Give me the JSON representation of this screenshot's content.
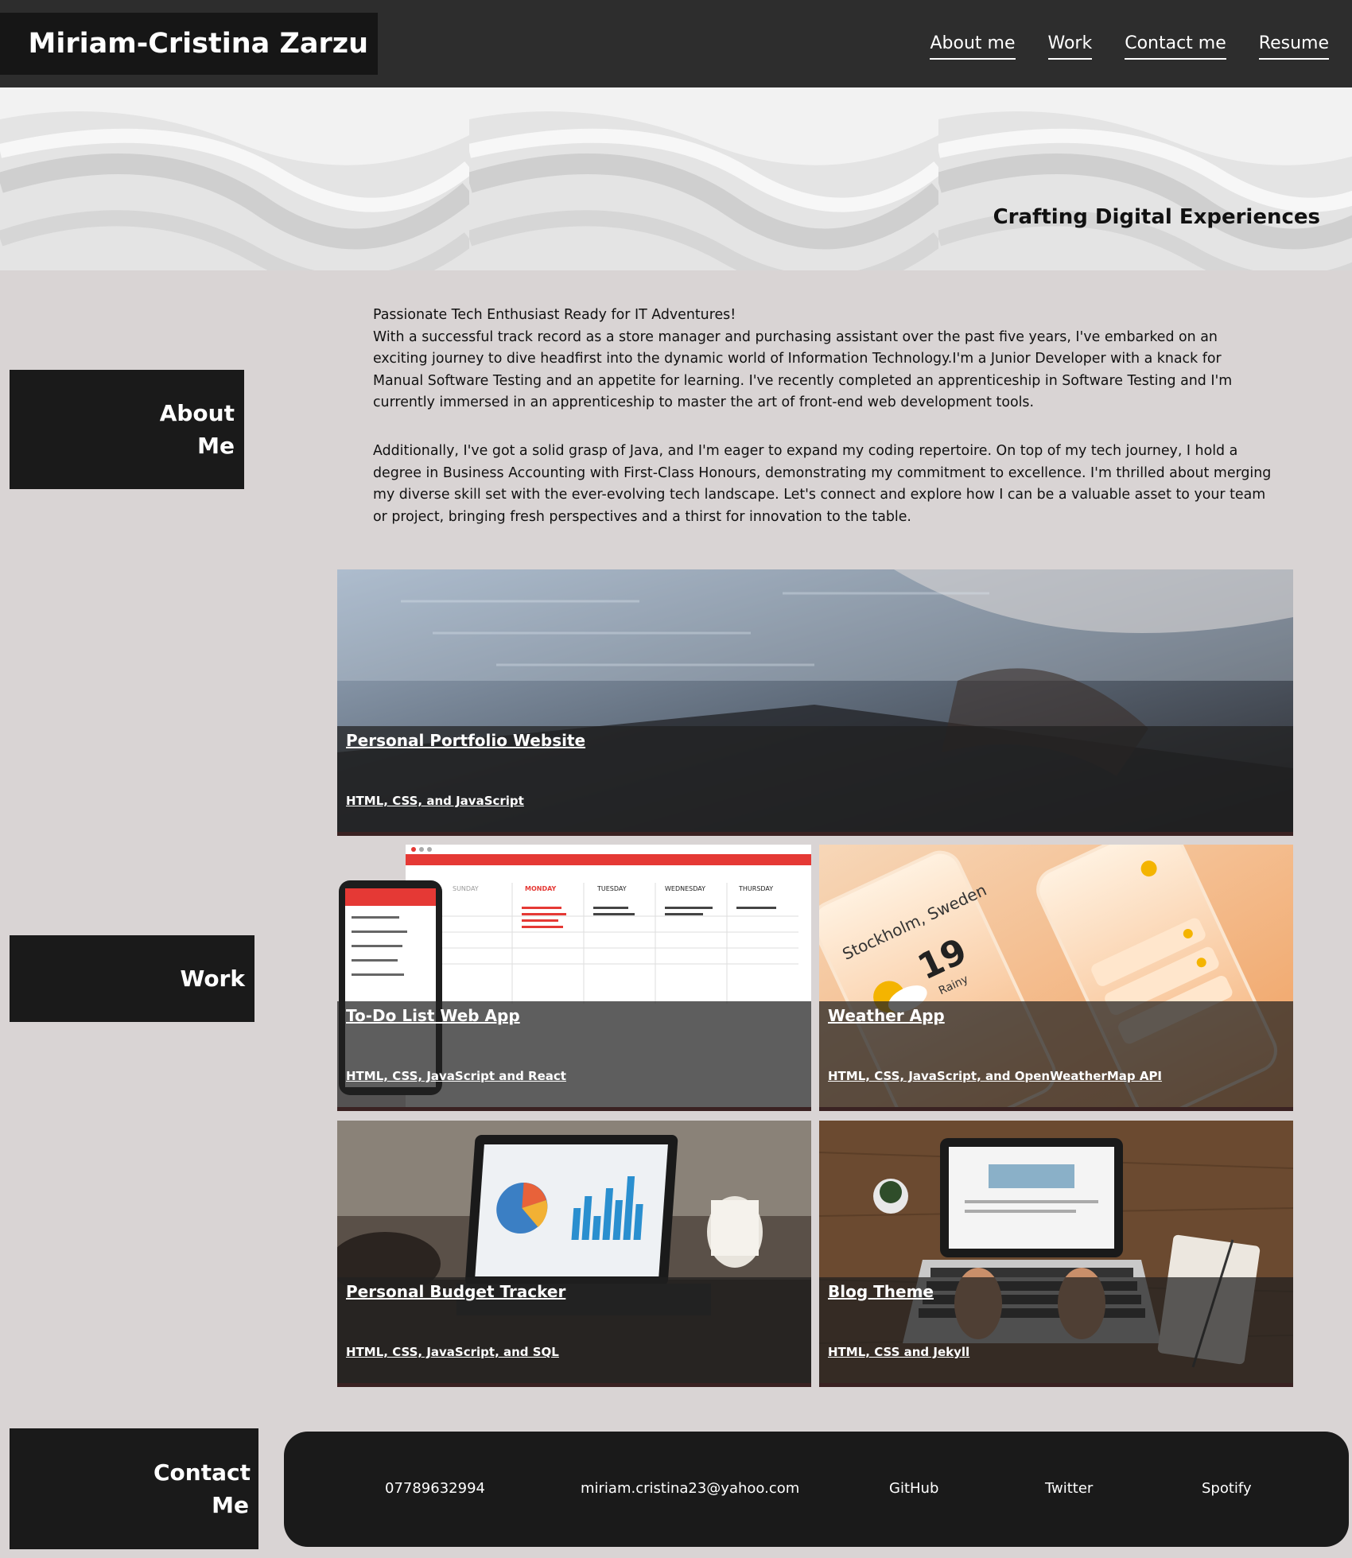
{
  "header": {
    "name": "Miriam-Cristina Zarzu",
    "nav": [
      "About me",
      "Work",
      "Contact me",
      "Resume"
    ]
  },
  "hero": {
    "tagline": "Crafting Digital Experiences"
  },
  "sections": {
    "about": "About Me",
    "work": "Work",
    "contact": "Contact Me"
  },
  "about": {
    "heading": "Passionate Tech Enthusiast Ready for IT Adventures!",
    "paragraph1": "With a successful track record as a store manager and purchasing assistant over the past five years, I've embarked on an exciting journey to dive headfirst into the dynamic world of Information Technology.I'm a Junior Developer with a knack for Manual Software Testing and an appetite for learning. I've recently completed an apprenticeship in Software Testing and I'm currently immersed in an apprenticeship to master the art of front-end web development tools.",
    "paragraph2": "Additionally, I've got a solid grasp of Java, and I'm eager to expand my coding repertoire. On top of my tech journey, I hold a degree in Business Accounting with First-Class Honours, demonstrating my commitment to excellence. I'm thrilled about merging my diverse skill set with the ever-evolving tech landscape. Let's connect and explore how I can be a valuable asset to your team or project, bringing fresh perspectives and a thirst for innovation to the table."
  },
  "work": {
    "projects": [
      {
        "title": "Personal Portfolio Website",
        "tech": "HTML, CSS, and JavaScript"
      },
      {
        "title": "To-Do List Web App",
        "tech": "HTML, CSS, JavaScript and React"
      },
      {
        "title": "Weather App",
        "tech": "HTML, CSS, JavaScript, and OpenWeatherMap API"
      },
      {
        "title": "Personal Budget Tracker",
        "tech": "HTML, CSS, JavaScript, and SQL"
      },
      {
        "title": "Blog Theme",
        "tech": "HTML, CSS and Jekyll"
      }
    ],
    "weather_preview": {
      "city": "Stockholm, Sweden",
      "temp": "19",
      "condition": "Rainy"
    },
    "todo_preview": {
      "days": [
        "SUNDAY",
        "MONDAY",
        "TUESDAY",
        "WEDNESDAY",
        "THURSDAY"
      ]
    }
  },
  "footer": {
    "phone": "07789632994",
    "email": "miriam.cristina23@yahoo.com",
    "links": [
      "GitHub",
      "Twitter",
      "Spotify"
    ]
  },
  "colors": {
    "header_bg": "#2d2d2d",
    "page_bg": "#d9d4d4",
    "label_bg": "#1a1a1a",
    "accent_red": "#e53935"
  }
}
